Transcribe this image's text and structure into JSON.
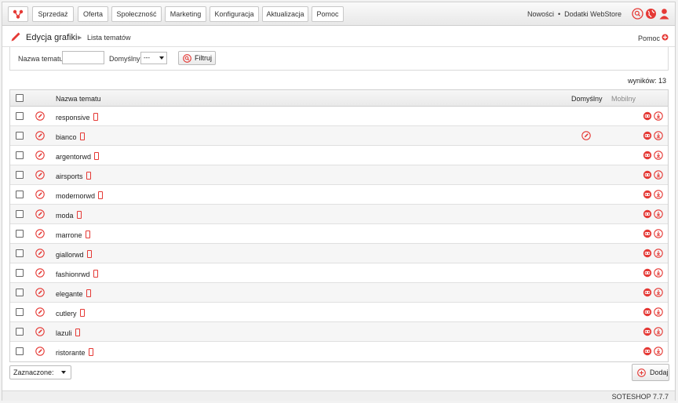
{
  "colors": {
    "accent": "#e53935",
    "border": "#d0d0d0"
  },
  "nav": {
    "items": [
      "Sprzedaż",
      "Oferta",
      "Społeczność",
      "Marketing",
      "Konfiguracja",
      "Aktualizacja",
      "Pomoc"
    ],
    "right_links": [
      "Nowości",
      "Dodatki WebStore"
    ],
    "separator": "•"
  },
  "breadcrumb": {
    "section": "Edycja grafiki",
    "separator": "▶",
    "page": "Lista tematów"
  },
  "help_label": "Pomoc",
  "filter": {
    "name_label": "Nazwa tematu",
    "name_value": "",
    "default_label": "Domyślny",
    "default_value": "---",
    "button_label": "Filtruj"
  },
  "results_label": "wyników: 13",
  "table": {
    "headers": {
      "name": "Nazwa tematu",
      "default": "Domyślny",
      "mobile": "Mobilny"
    },
    "rows": [
      {
        "name": "responsive",
        "default": false
      },
      {
        "name": "bianco",
        "default": true
      },
      {
        "name": "argentorwd",
        "default": false
      },
      {
        "name": "airsports",
        "default": false
      },
      {
        "name": "modernorwd",
        "default": false
      },
      {
        "name": "moda",
        "default": false
      },
      {
        "name": "marrone",
        "default": false
      },
      {
        "name": "giallorwd",
        "default": false
      },
      {
        "name": "fashionrwd",
        "default": false
      },
      {
        "name": "elegante",
        "default": false
      },
      {
        "name": "cutlery",
        "default": false
      },
      {
        "name": "lazuli",
        "default": false
      },
      {
        "name": "ristorante",
        "default": false
      }
    ]
  },
  "bulk_select_label": "Zaznaczone:",
  "add_button_label": "Dodaj",
  "footer_version": "SOTESHOP 7.7.7",
  "icons": {
    "logo": "soteshop-logo-icon",
    "row_edit": "edit-circle-icon",
    "phone": "mobile-phone-icon",
    "duplicate": "duplicate-icon",
    "download": "download-icon"
  }
}
